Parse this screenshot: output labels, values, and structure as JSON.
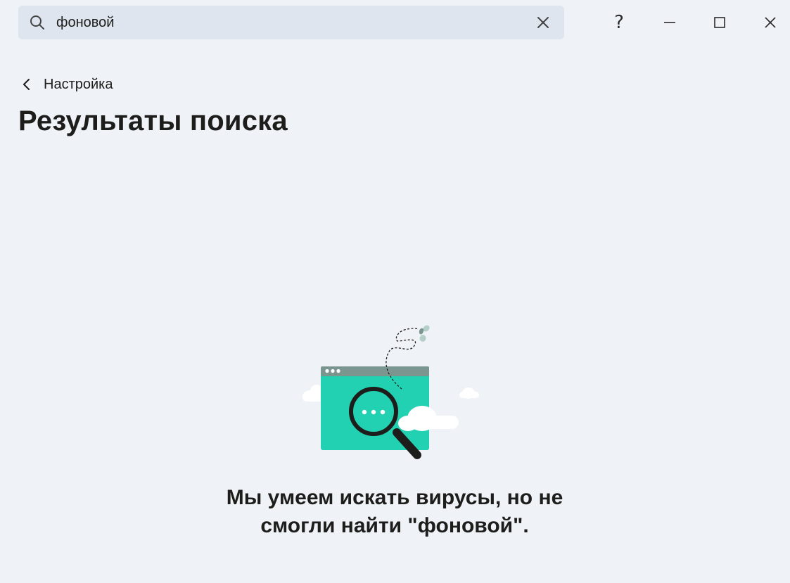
{
  "search": {
    "value": "фоновой",
    "icon": "search-icon",
    "clear_icon": "close-icon"
  },
  "window": {
    "help_label": "?",
    "controls": [
      "help-icon",
      "minimize-icon",
      "maximize-icon",
      "close-icon"
    ]
  },
  "nav": {
    "back_label": "Настройка",
    "back_icon": "chevron-left-icon"
  },
  "page": {
    "title": "Результаты поиска"
  },
  "empty_state": {
    "line1": "Мы умеем искать вирусы, но не",
    "line2": "смогли найти \"фоновой\"."
  },
  "colors": {
    "background": "#eff2f7",
    "search_bg": "#dee5ee",
    "accent": "#22d1b1",
    "window_header": "#7a968f",
    "text": "#1d1d1b"
  }
}
